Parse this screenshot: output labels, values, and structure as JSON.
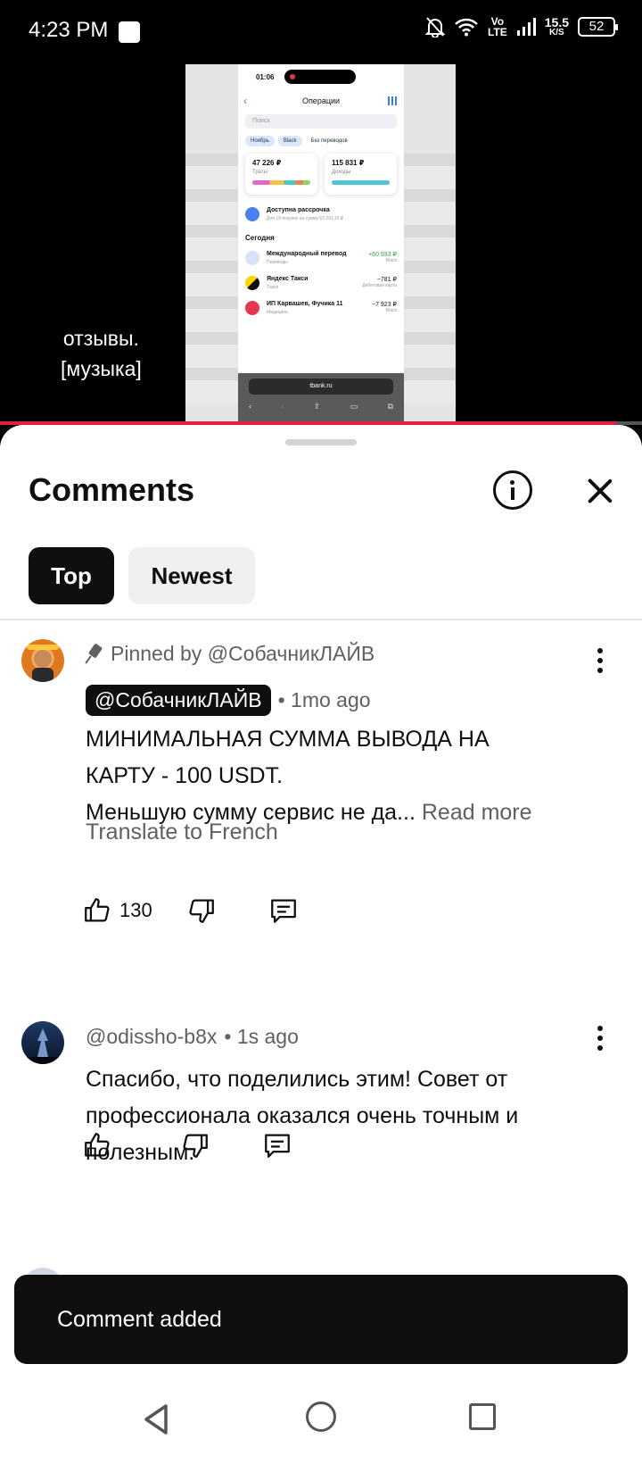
{
  "status_bar": {
    "time": "4:23 PM",
    "network_top": "Vo",
    "network_bottom": "LTE",
    "speed_top": "15.5",
    "speed_bottom": "K/S",
    "battery": "52"
  },
  "video": {
    "subtitle_line1": "отзывы.",
    "subtitle_line2": "[музыка]",
    "progress_fraction": 0.96,
    "phone": {
      "time": "01:06",
      "header": "Операции",
      "search_placeholder": "Поиск",
      "chips": [
        "Ноябрь",
        "Black",
        "Без переводов"
      ],
      "card1_amount": "47 226 ₽",
      "card1_label": "Траты",
      "card2_amount": "115 831 ₽",
      "card2_label": "Доходы",
      "installment_title": "Доступна рассрочка",
      "installment_sub": "Для 19 покупок на сумму 63 291,16 ₽",
      "section": "Сегодня",
      "rows": [
        {
          "title": "Международный перевод",
          "sub": "Переводы",
          "amount": "+60 933 ₽",
          "account": "Black"
        },
        {
          "title": "Яндекс Такси",
          "sub": "Такси",
          "amount": "−781 ₽",
          "account": "Дебетовая карта"
        },
        {
          "title": "ИП Карвашев, Фучика 11",
          "sub": "Медицина",
          "amount": "−7 923 ₽",
          "account": "Black"
        }
      ],
      "url": "tbank.ru"
    }
  },
  "sheet": {
    "title": "Comments",
    "tabs": [
      {
        "label": "Top",
        "selected": true
      },
      {
        "label": "Newest",
        "selected": false
      }
    ]
  },
  "comments": [
    {
      "pinned_by": "Pinned by @СобачникЛАЙВ",
      "author": "@СобачникЛАЙВ",
      "time": "• 1mo ago",
      "text_line1": "МИНИМАЛЬНАЯ СУММА ВЫВОДА НА",
      "text_line2": "КАРТУ - 100 USDT.",
      "text_line3": "Меньшую сумму сервис не да...",
      "read_more": "Read more",
      "translate": "Translate to French",
      "likes": "130"
    },
    {
      "author": "@odissho-b8x",
      "time": "• 1s ago",
      "text_line1": "Спасибо, что поделились этим! Совет от",
      "text_line2": "профессионала оказался очень точным и",
      "text_line3": "полезным."
    }
  ],
  "toast": "Comment added",
  "colors": {
    "accent_red": "#e41f3c",
    "text_primary": "#0f0f0f",
    "text_secondary": "#606060"
  },
  "icons": {
    "like": "thumb-up-icon",
    "dislike": "thumb-down-icon",
    "reply": "reply-icon",
    "more": "more-vert-icon",
    "pin": "pin-icon",
    "info": "info-icon",
    "close": "close-icon"
  }
}
